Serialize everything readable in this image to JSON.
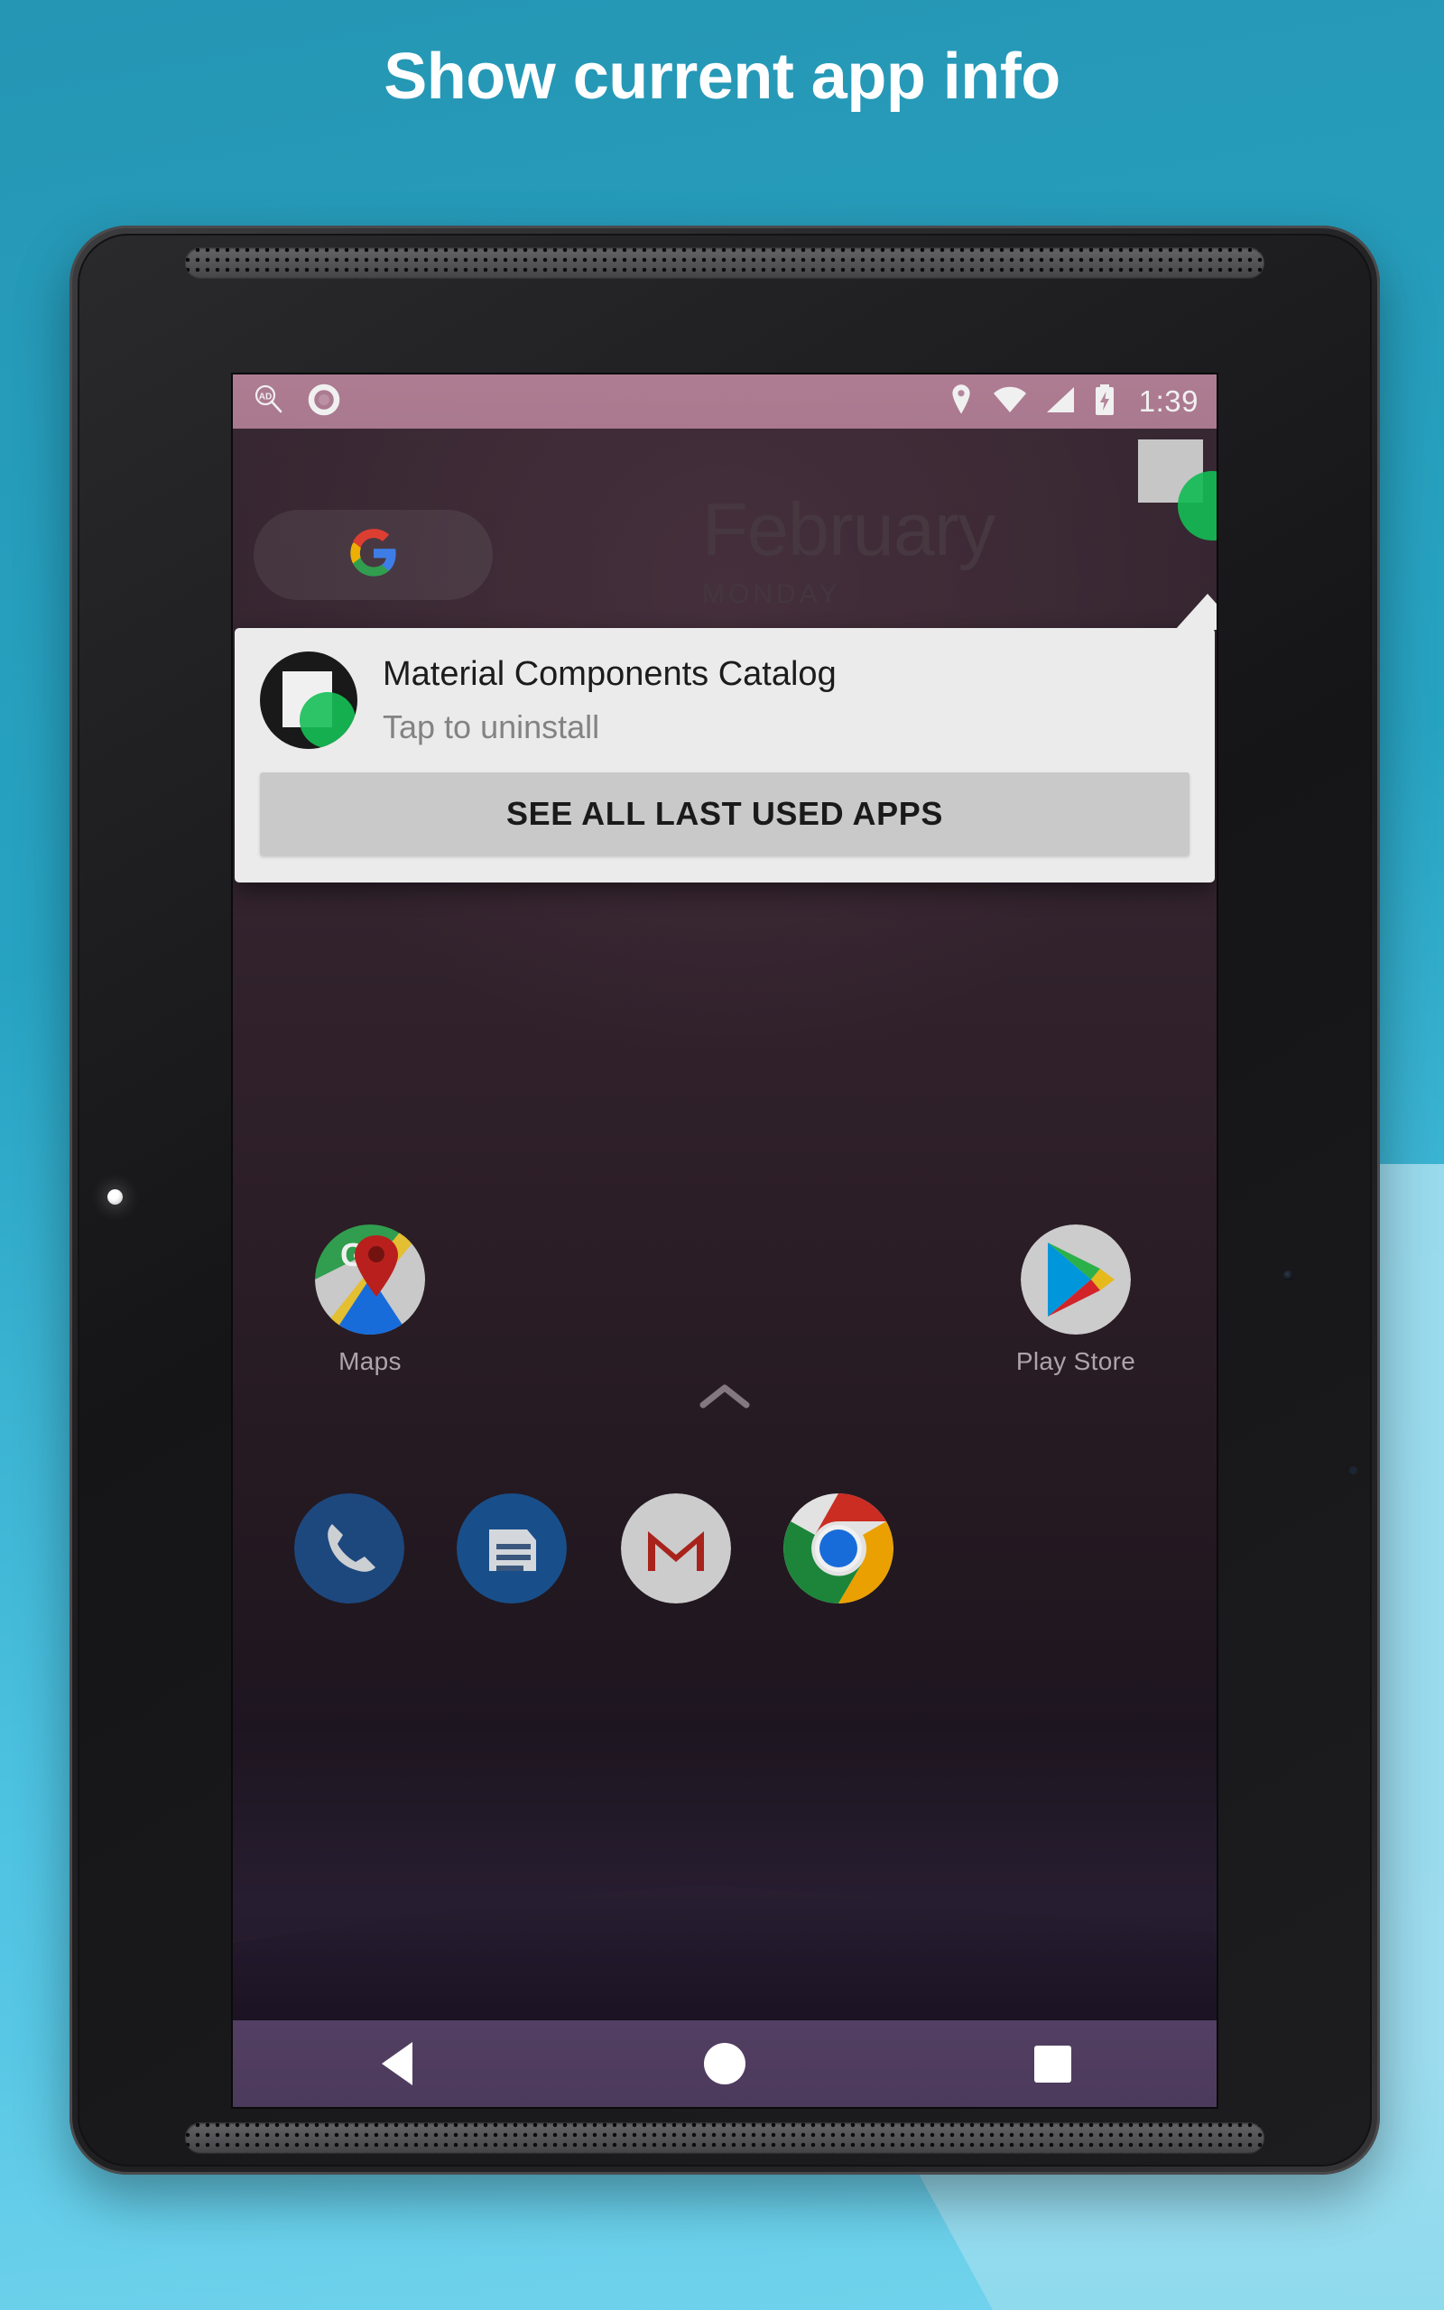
{
  "page": {
    "headline": "Show current app info",
    "background_color": "#23a0bd",
    "accent_color": "#9fdcee"
  },
  "device": {
    "frame_label": "android-tablet-frame",
    "bezel_color": "#1c1c1e",
    "led_label": "notification-led"
  },
  "status_bar": {
    "background_color": "#c48ca5",
    "left_icons": [
      {
        "name": "ad-search-icon",
        "label": "AD"
      },
      {
        "name": "recorder-ring-icon",
        "label": ""
      }
    ],
    "right_icons": [
      {
        "name": "location-pin-icon"
      },
      {
        "name": "wifi-icon"
      },
      {
        "name": "cellular-signal-icon"
      },
      {
        "name": "battery-charging-icon"
      }
    ],
    "time": "1:39"
  },
  "home_screen": {
    "date_widget": {
      "month": "February",
      "day": "MONDAY"
    },
    "search_pill": {
      "icon": "google-g-icon"
    },
    "apps": [
      {
        "name": "maps",
        "label": "Maps",
        "icon": "google-maps-icon"
      },
      {
        "name": "play-store",
        "label": "Play Store",
        "icon": "google-play-icon"
      }
    ],
    "app_drawer": {
      "icon": "chevron-up-icon"
    },
    "dock": [
      {
        "name": "phone",
        "icon": "phone-icon",
        "color": "#1f4d86"
      },
      {
        "name": "messages",
        "icon": "messages-icon",
        "color": "#1a5493"
      },
      {
        "name": "gmail",
        "icon": "gmail-icon",
        "color": "#d9d9d9"
      },
      {
        "name": "chrome",
        "icon": "chrome-icon",
        "color": "#ffffff"
      }
    ]
  },
  "floating_badge": {
    "name": "current-app-floating-badge",
    "square_color": "#d3d3d3",
    "circle_color": "#16c65a"
  },
  "dialog": {
    "app_name": "Material Components Catalog",
    "action_hint": "Tap to uninstall",
    "button_label": "SEE ALL LAST USED APPS",
    "icon": {
      "background_color": "#1b1b1b",
      "square_color": "#ffffff",
      "circle_color": "#18cc5d"
    },
    "background_color": "#fafafa",
    "button_color": "#d6d6d6"
  },
  "nav_bar": {
    "background_color": "#4c3a5c",
    "buttons": [
      {
        "name": "back-button",
        "icon": "triangle-left-icon"
      },
      {
        "name": "home-button",
        "icon": "circle-icon"
      },
      {
        "name": "recents-button",
        "icon": "square-icon"
      }
    ]
  }
}
